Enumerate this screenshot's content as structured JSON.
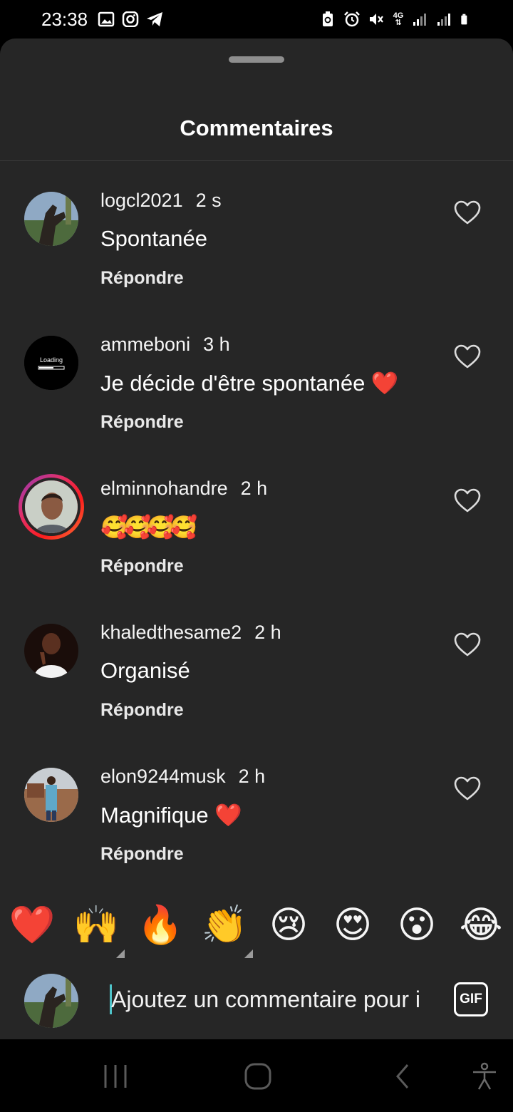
{
  "status_bar": {
    "time": "23:38",
    "left_icons": [
      "image-icon",
      "instagram-icon",
      "telegram-icon"
    ],
    "right_icons": [
      "battery-saver-icon",
      "alarm-icon",
      "mute-icon",
      "network-4g-icon",
      "signal-icon",
      "signal-icon",
      "battery-icon"
    ],
    "network_label": "4G"
  },
  "sheet": {
    "title": "Commentaires"
  },
  "comments": [
    {
      "username": "logcl2021",
      "time": "2 s",
      "text": "Spontanée",
      "reply_label": "Répondre"
    },
    {
      "username": "ammeboni",
      "time": "3 h",
      "text": "Je décide d'être spontanée ❤️",
      "reply_label": "Répondre",
      "avatar_text": "Loading"
    },
    {
      "username": "elminnohandre",
      "time": "2 h",
      "text": "🥰🥰🥰🥰",
      "reply_label": "Répondre"
    },
    {
      "username": "khaledthesame2",
      "time": "2 h",
      "text": "Organisé",
      "reply_label": "Répondre"
    },
    {
      "username": "elon9244musk",
      "time": "2 h",
      "text": "Magnifique ❤️",
      "reply_label": "Répondre"
    }
  ],
  "reactions": [
    "❤️",
    "🙌",
    "🔥",
    "👏",
    "😢",
    "😍",
    "😮",
    "😂"
  ],
  "composer": {
    "placeholder": "Ajoutez un commentaire pour i",
    "gif_label": "GIF"
  },
  "colors": {
    "sheet_bg": "#262626",
    "accent_caret": "#4fc3c9",
    "story_ring": "#e1306c"
  }
}
